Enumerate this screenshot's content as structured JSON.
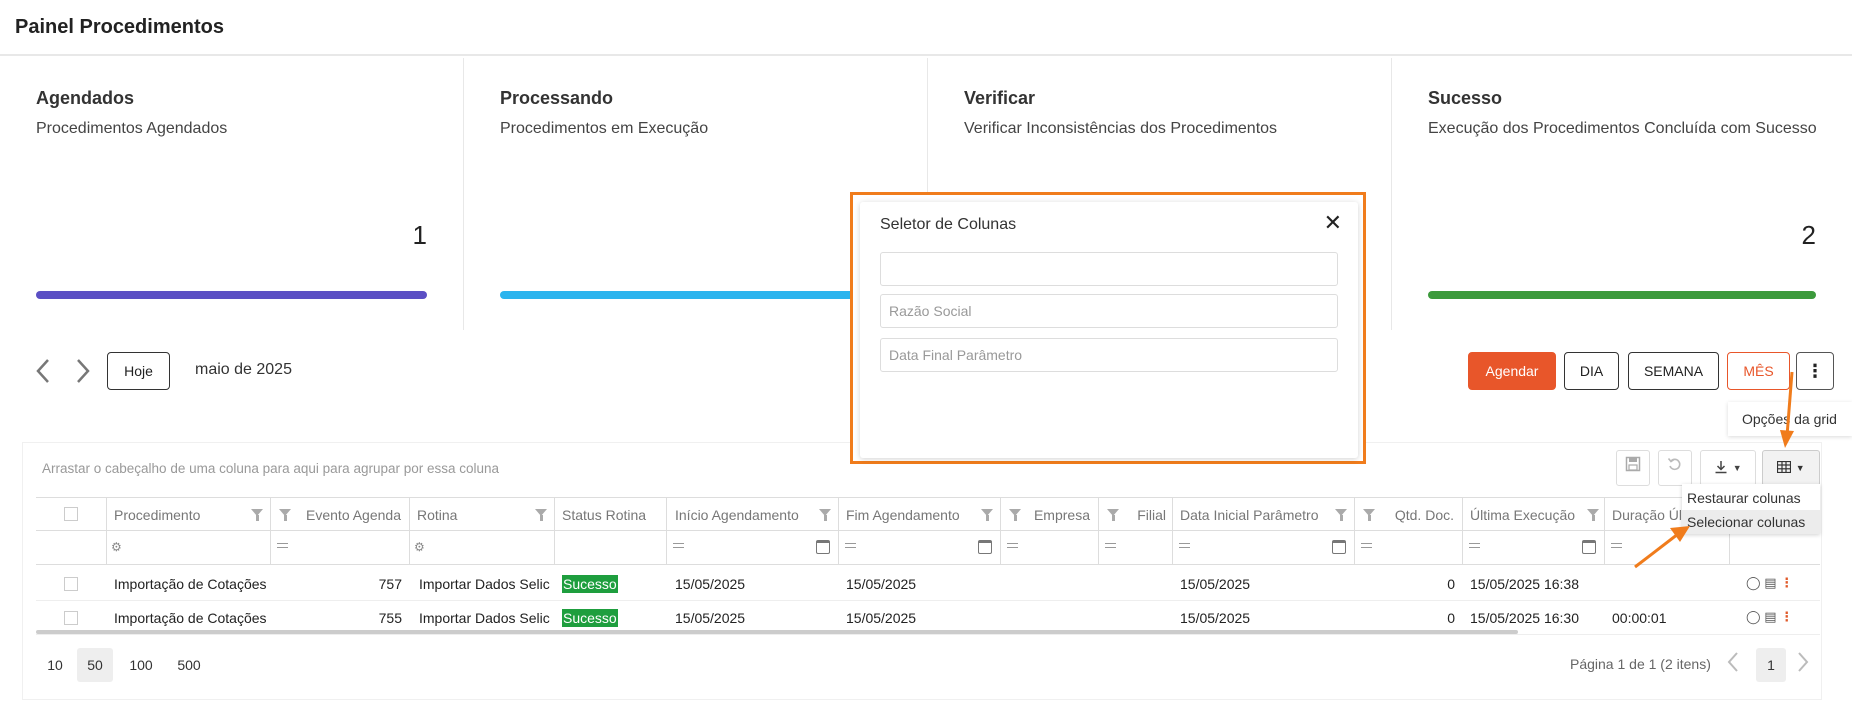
{
  "header": {
    "title": "Painel Procedimentos"
  },
  "cards": [
    {
      "title": "Agendados",
      "subtitle": "Procedimentos Agendados",
      "count": "1",
      "bar_color": "#5b4fc4"
    },
    {
      "title": "Processando",
      "subtitle": "Procedimentos em Execução",
      "count": "",
      "bar_color": "#2bb4ee"
    },
    {
      "title": "Verificar",
      "subtitle": "Verificar Inconsistências dos Procedimentos",
      "count": "",
      "bar_color": "#f0a030"
    },
    {
      "title": "Sucesso",
      "subtitle": "Execução dos Procedimentos Concluída com Sucesso",
      "count": "2",
      "bar_color": "#3c9a3c"
    }
  ],
  "toolbar": {
    "prev_icon": "chevron-left-icon",
    "next_icon": "chevron-right-icon",
    "today_label": "Hoje",
    "month_label": "maio de 2025",
    "schedule_label": "Agendar",
    "day_label": "DIA",
    "week_label": "SEMANA",
    "month_view_label": "MÊS",
    "more_icon": "kebab-vertical-icon",
    "accent_color": "#e8562a"
  },
  "grid_options_menu": {
    "label": "Opções da grid"
  },
  "grid": {
    "group_hint": "Arrastar o cabeçalho de uma coluna para aqui para agrupar por essa coluna",
    "tools": {
      "save_icon": "save-icon",
      "undo_icon": "undo-icon",
      "export_icon": "download-icon",
      "columns_icon": "table-columns-icon"
    },
    "columns": [
      "Procedimento",
      "Evento Agenda",
      "Rotina",
      "Status Rotina",
      "Início Agendamento",
      "Fim Agendamento",
      "Empresa",
      "Filial",
      "Data Inicial Parâmetro",
      "Qtd. Doc.",
      "Última Execução",
      "Duração Úl"
    ],
    "rows": [
      {
        "procedimento": "Importação de Cotações",
        "evento": "757",
        "rotina": "Importar Dados Selic",
        "status": "Sucesso",
        "inicio": "15/05/2025",
        "fim": "15/05/2025",
        "empresa": "",
        "filial": "",
        "data_inicial": "15/05/2025",
        "qtd": "0",
        "ultima": "15/05/2025 16:38",
        "duracao": ""
      },
      {
        "procedimento": "Importação de Cotações",
        "evento": "755",
        "rotina": "Importar Dados Selic",
        "status": "Sucesso",
        "inicio": "15/05/2025",
        "fim": "15/05/2025",
        "empresa": "",
        "filial": "",
        "data_inicial": "15/05/2025",
        "qtd": "0",
        "ultima": "15/05/2025 16:30",
        "duracao": "00:00:01"
      }
    ],
    "page_sizes": [
      "10",
      "50",
      "100",
      "500"
    ],
    "page_size_selected": "50",
    "page_info": "Página 1 de 1 (2 itens)",
    "current_page": "1"
  },
  "column_menu": {
    "restore_label": "Restaurar colunas",
    "select_label": "Selecionar colunas"
  },
  "column_selector": {
    "title": "Seletor de Colunas",
    "close_icon": "close-icon",
    "items": [
      "",
      "Razão Social",
      "Data Final Parâmetro"
    ]
  },
  "annotation_color": "#f07c1c"
}
